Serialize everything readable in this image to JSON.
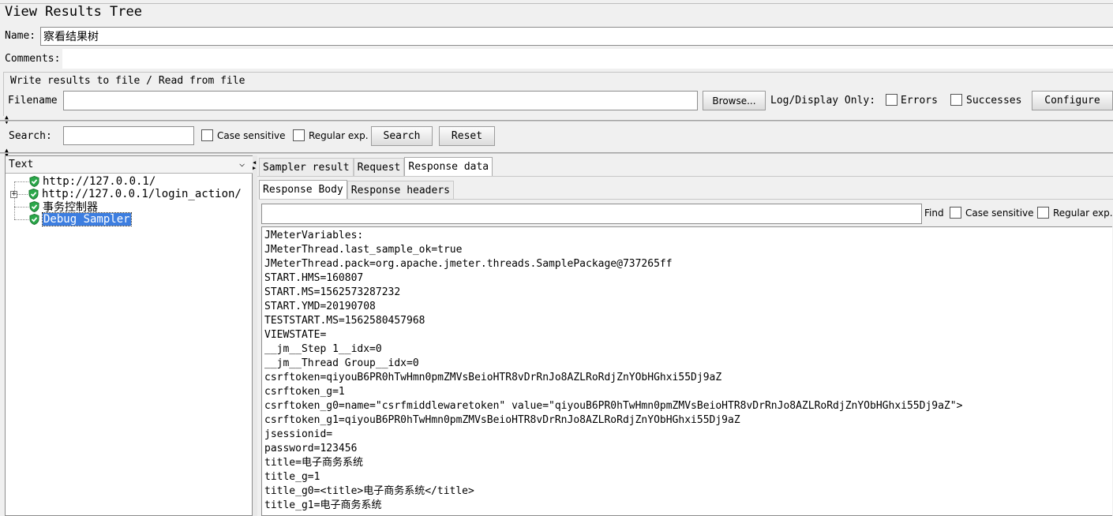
{
  "window": {
    "title": "View Results Tree"
  },
  "name_row": {
    "label": "Name:",
    "value": "察看结果树"
  },
  "comments_row": {
    "label": "Comments:",
    "value": ""
  },
  "file_group": {
    "title": "Write results to file / Read from file",
    "filename_label": "Filename",
    "filename_value": "",
    "browse_label": "Browse...",
    "log_display_label": "Log/Display Only:",
    "errors_label": "Errors",
    "successes_label": "Successes",
    "configure_label": "Configure"
  },
  "search_bar": {
    "label": "Search:",
    "value": "",
    "case_sensitive_label": "Case sensitive",
    "regex_label": "Regular exp.",
    "search_button": "Search",
    "reset_button": "Reset"
  },
  "renderer": {
    "selected": "Text"
  },
  "tree": {
    "items": [
      {
        "label": "http://127.0.0.1/",
        "expandable": false,
        "selected": false
      },
      {
        "label": "http://127.0.0.1/login_action/",
        "expandable": true,
        "selected": false
      },
      {
        "label": "事务控制器",
        "expandable": false,
        "selected": false
      },
      {
        "label": "Debug Sampler",
        "expandable": false,
        "selected": true
      }
    ]
  },
  "main_tabs": [
    {
      "label": "Sampler result",
      "active": false
    },
    {
      "label": "Request",
      "active": false
    },
    {
      "label": "Response data",
      "active": true
    }
  ],
  "sub_tabs": [
    {
      "label": "Response Body",
      "active": true
    },
    {
      "label": "Response headers",
      "active": false
    }
  ],
  "find_bar": {
    "value": "",
    "find_label": "Find",
    "case_sensitive_label": "Case sensitive",
    "regex_label": "Regular exp."
  },
  "response_lines": [
    "JMeterVariables:",
    "JMeterThread.last_sample_ok=true",
    "JMeterThread.pack=org.apache.jmeter.threads.SamplePackage@737265ff",
    "START.HMS=160807",
    "START.MS=1562573287232",
    "START.YMD=20190708",
    "TESTSTART.MS=1562580457968",
    "VIEWSTATE=",
    "__jm__Step 1__idx=0",
    "__jm__Thread Group__idx=0",
    "csrftoken=qiyouB6PR0hTwHmn0pmZMVsBeioHTR8vDrRnJo8AZLRoRdjZnYObHGhxi55Dj9aZ",
    "csrftoken_g=1",
    "csrftoken_g0=name=\"csrfmiddlewaretoken\" value=\"qiyouB6PR0hTwHmn0pmZMVsBeioHTR8vDrRnJo8AZLRoRdjZnYObHGhxi55Dj9aZ\">",
    "csrftoken_g1=qiyouB6PR0hTwHmn0pmZMVsBeioHTR8vDrRnJo8AZLRoRdjZnYObHGhxi55Dj9aZ",
    "jsessionid=",
    "password=123456",
    "title=电子商务系统",
    "title_g=1",
    "title_g0=<title>电子商务系统</title>",
    "title_g1=电子商务系统"
  ],
  "colors": {
    "selection_bg": "#3d7ee0",
    "shield_green": "#2aa84a",
    "panel_bg": "#f0f0f0"
  }
}
